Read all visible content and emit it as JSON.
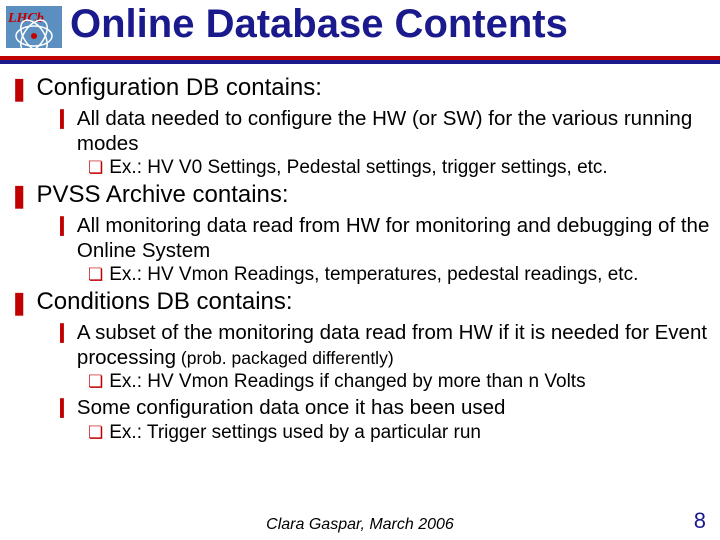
{
  "title": "Online Database Contents",
  "sections": [
    {
      "heading": "Configuration DB contains:",
      "items": [
        {
          "text": "All data needed to configure the HW (or SW) for the various running modes",
          "sub": [
            "Ex.: HV V0 Settings, Pedestal settings, trigger settings, etc."
          ]
        }
      ]
    },
    {
      "heading": "PVSS Archive contains:",
      "items": [
        {
          "text": "All monitoring data read from HW for monitoring and debugging of the Online System",
          "sub": [
            "Ex.: HV Vmon Readings, temperatures, pedestal readings, etc."
          ]
        }
      ]
    },
    {
      "heading": "Conditions DB contains:",
      "items": [
        {
          "text": "A subset of the monitoring data read from HW if it is needed for Event processing",
          "text_suffix_small": " (prob. packaged differently)",
          "sub": [
            "Ex.: HV Vmon Readings if changed by more than n Volts"
          ]
        },
        {
          "text": "Some configuration data once it has been used",
          "sub": [
            "Ex.: Trigger settings used by a particular run"
          ]
        }
      ]
    }
  ],
  "footer": "Clara Gaspar, March 2006",
  "page_number": "8",
  "logo_label": "LHCb"
}
